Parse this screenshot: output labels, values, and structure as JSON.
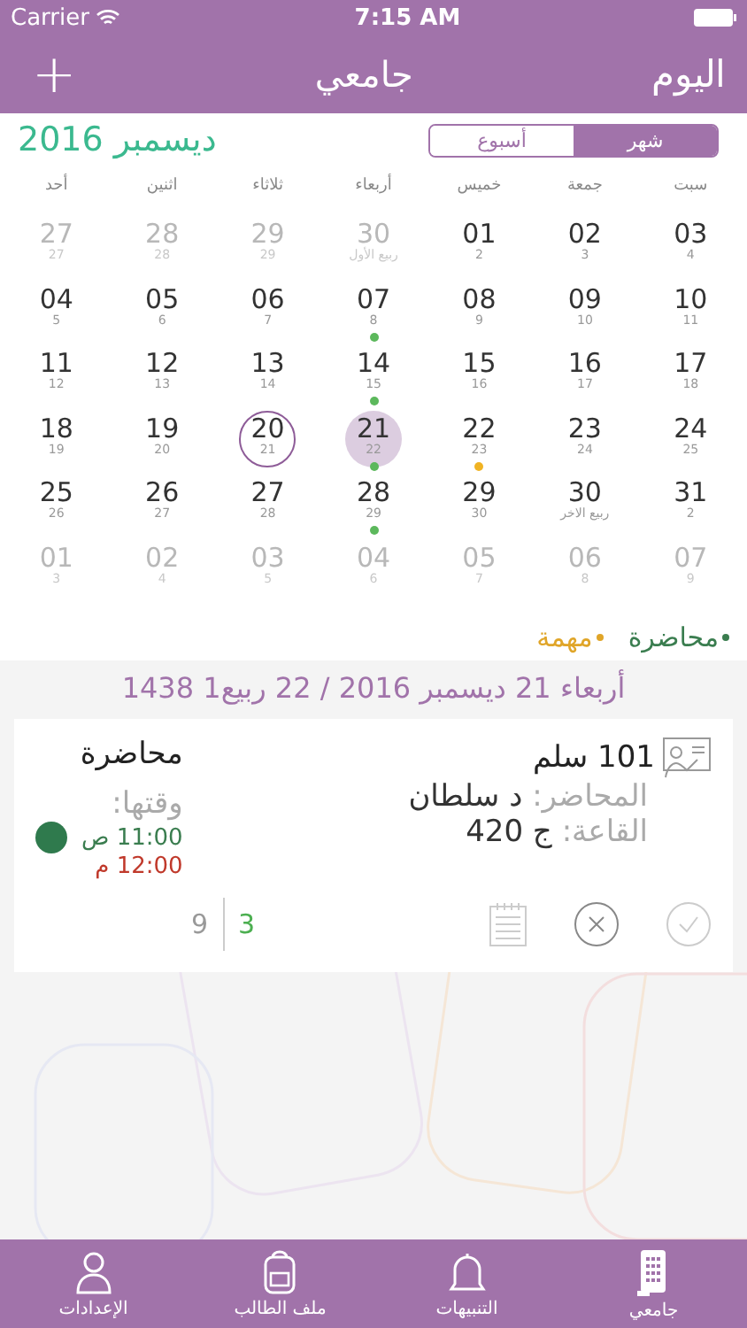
{
  "status_bar": {
    "carrier": "Carrier",
    "time": "7:15 AM"
  },
  "nav": {
    "left": "+",
    "title": "جامعي",
    "right": "اليوم"
  },
  "month_title": "ديسمبر 2016",
  "view_switch": [
    {
      "label": "شهر",
      "selected": true
    },
    {
      "label": "أسبوع",
      "selected": false
    }
  ],
  "weekdays": [
    "سبت",
    "جمعة",
    "خميس",
    "أربعاء",
    "ثلاثاء",
    "اثنين",
    "أحد"
  ],
  "days": [
    {
      "day": "03",
      "sub": "4",
      "faded": false,
      "selected": false,
      "today": false
    },
    {
      "day": "02",
      "sub": "3",
      "faded": false,
      "selected": false,
      "today": false
    },
    {
      "day": "01",
      "sub": "2",
      "faded": false,
      "selected": false,
      "today": false
    },
    {
      "day": "30",
      "sub": "ربيع الأول",
      "faded": true,
      "selected": false,
      "today": false
    },
    {
      "day": "29",
      "sub": "29",
      "faded": true,
      "selected": false,
      "today": false
    },
    {
      "day": "28",
      "sub": "28",
      "faded": true,
      "selected": false,
      "today": false
    },
    {
      "day": "27",
      "sub": "27",
      "faded": true,
      "selected": false,
      "today": false
    },
    {
      "day": "10",
      "sub": "11",
      "faded": false,
      "selected": false,
      "today": false
    },
    {
      "day": "09",
      "sub": "10",
      "faded": false,
      "selected": false,
      "today": false
    },
    {
      "day": "08",
      "sub": "9",
      "faded": false,
      "selected": false,
      "today": false
    },
    {
      "day": "07",
      "sub": "8",
      "faded": false,
      "selected": false,
      "today": false,
      "color": "#5cb85c"
    },
    {
      "day": "06",
      "sub": "7",
      "faded": false,
      "selected": false,
      "today": false
    },
    {
      "day": "05",
      "sub": "6",
      "faded": false,
      "selected": false,
      "today": false
    },
    {
      "day": "04",
      "sub": "5",
      "faded": false,
      "selected": false,
      "today": false
    },
    {
      "day": "17",
      "sub": "18",
      "faded": false,
      "selected": false,
      "today": false
    },
    {
      "day": "16",
      "sub": "17",
      "faded": false,
      "selected": false,
      "today": false
    },
    {
      "day": "15",
      "sub": "16",
      "faded": false,
      "selected": false,
      "today": false
    },
    {
      "day": "14",
      "sub": "15",
      "faded": false,
      "selected": false,
      "today": false,
      "color": "#5cb85c"
    },
    {
      "day": "13",
      "sub": "14",
      "faded": false,
      "selected": false,
      "today": false
    },
    {
      "day": "12",
      "sub": "13",
      "faded": false,
      "selected": false,
      "today": false
    },
    {
      "day": "11",
      "sub": "12",
      "faded": false,
      "selected": false,
      "today": false
    },
    {
      "day": "24",
      "sub": "25",
      "faded": false,
      "selected": false,
      "today": false
    },
    {
      "day": "23",
      "sub": "24",
      "faded": false,
      "selected": false,
      "today": false
    },
    {
      "day": "22",
      "sub": "23",
      "faded": false,
      "selected": false,
      "today": false,
      "color": "#f0b323"
    },
    {
      "day": "21",
      "sub": "22",
      "faded": false,
      "selected": true,
      "today": false,
      "color": "#5cb85c"
    },
    {
      "day": "20",
      "sub": "21",
      "faded": false,
      "selected": false,
      "today": true
    },
    {
      "day": "19",
      "sub": "20",
      "faded": false,
      "selected": false,
      "today": false
    },
    {
      "day": "18",
      "sub": "19",
      "faded": false,
      "selected": false,
      "today": false
    },
    {
      "day": "31",
      "sub": "2",
      "faded": false,
      "selected": false,
      "today": false
    },
    {
      "day": "30",
      "sub": "ربيع الاخر",
      "faded": false,
      "selected": false,
      "today": false
    },
    {
      "day": "29",
      "sub": "30",
      "faded": false,
      "selected": false,
      "today": false
    },
    {
      "day": "28",
      "sub": "29",
      "faded": false,
      "selected": false,
      "today": false,
      "color": "#5cb85c"
    },
    {
      "day": "27",
      "sub": "28",
      "faded": false,
      "selected": false,
      "today": false
    },
    {
      "day": "26",
      "sub": "27",
      "faded": false,
      "selected": false,
      "today": false
    },
    {
      "day": "25",
      "sub": "26",
      "faded": false,
      "selected": false,
      "today": false
    },
    {
      "day": "07",
      "sub": "9",
      "faded": true,
      "selected": false,
      "today": false
    },
    {
      "day": "06",
      "sub": "8",
      "faded": true,
      "selected": false,
      "today": false
    },
    {
      "day": "05",
      "sub": "7",
      "faded": true,
      "selected": false,
      "today": false
    },
    {
      "day": "04",
      "sub": "6",
      "faded": true,
      "selected": false,
      "today": false
    },
    {
      "day": "03",
      "sub": "5",
      "faded": true,
      "selected": false,
      "today": false
    },
    {
      "day": "02",
      "sub": "4",
      "faded": true,
      "selected": false,
      "today": false
    },
    {
      "day": "01",
      "sub": "3",
      "faded": true,
      "selected": false,
      "today": false
    }
  ],
  "legend": [
    {
      "label": "محاضرة",
      "color": "#3a7d4f"
    },
    {
      "label": "مهمة",
      "color": "#e0a528"
    }
  ],
  "date_heading": "أربعاء 21 ديسمبر 2016 / 22 ربيع1 1438",
  "event": {
    "title": "101 سلم",
    "type": "محاضرة",
    "lecturer_label": "المحاضر:",
    "lecturer": "د سلطان",
    "room_label": "القاعة:",
    "room": "ج 420",
    "time_label": "وقتها:",
    "start": "11:00 ص",
    "end": "12:00 م",
    "attended": "3",
    "total": "9"
  },
  "tabs": [
    {
      "label": "جامعي",
      "kind": "building"
    },
    {
      "label": "التنبيهات",
      "kind": "bell"
    },
    {
      "label": "ملف الطالب",
      "kind": "backpack"
    },
    {
      "label": "الإعدادات",
      "kind": "user"
    }
  ]
}
